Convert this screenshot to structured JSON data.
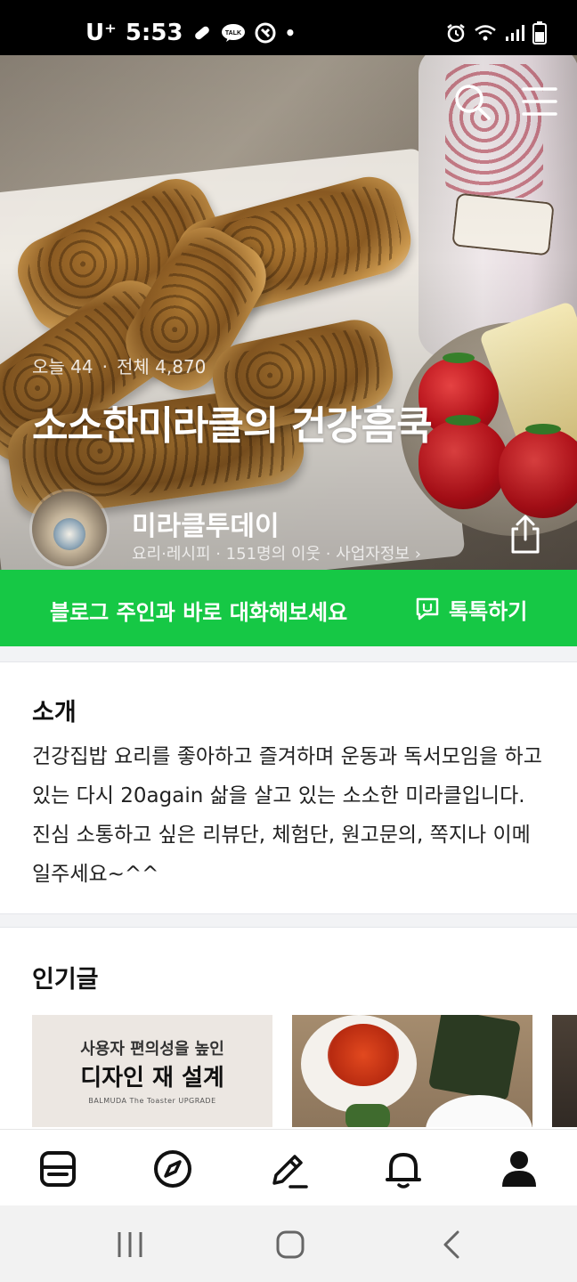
{
  "status_bar": {
    "carrier": "U⁺",
    "time": "5:53",
    "dot": "•",
    "talk_badge": "TALK"
  },
  "hero": {
    "visits_today": "오늘 44",
    "visits_total": "전체 4,870",
    "separator": "·",
    "blog_title": "소소한미라클의 건강흠쿡",
    "nickname": "미라클투데이",
    "meta": "요리·레시피 · 151명의 이웃 · 사업자정보 ›",
    "icons": [
      "search-icon",
      "menu-icon",
      "share-icon"
    ]
  },
  "talk_banner": {
    "text": "블로그 주인과 바로 대화해보세요",
    "button_label": "톡톡하기",
    "color": "#16c845"
  },
  "intro": {
    "title": "소개",
    "body": "건강집밥 요리를 좋아하고 즐겨하며 운동과 독서모임을 하고 있는 다시 20again 삶을 살고 있는 소소한 미라클입니다. 진심 소통하고 싶은 리뷰단, 체험단, 원고문의, 쪽지나 이메일주세요~^^"
  },
  "popular": {
    "title": "인기글",
    "cards": [
      {
        "line1": "사용자 편의성을 높인",
        "line2": "디자인 재 설계",
        "line3": "BALMUDA The Toaster UPGRADE"
      }
    ]
  },
  "tab_bar": {
    "items": [
      "feed-icon",
      "discover-icon",
      "write-icon",
      "notification-icon",
      "profile-icon"
    ]
  },
  "system_nav": {
    "items": [
      "recent-apps-icon",
      "home-icon",
      "back-icon"
    ]
  }
}
